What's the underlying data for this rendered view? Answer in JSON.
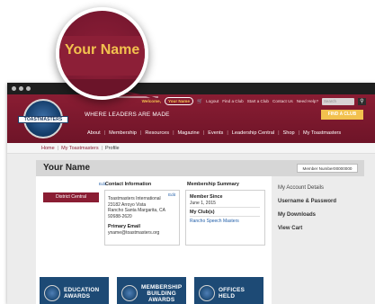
{
  "magnifier": {
    "text": "Your Name"
  },
  "topnav": {
    "welcome": "Welcome,",
    "name": "Your Name",
    "logout": "Logout",
    "find_club": "Find a Club",
    "start_club": "Start a Club",
    "contact": "Contact Us",
    "need_help": "Need Help?",
    "search_placeholder": "Search"
  },
  "brand": {
    "logo_text": "TOASTMASTERS",
    "tagline": "WHERE LEADERS ARE MADE",
    "find_club_button": "FIND A CLUB"
  },
  "mainnav": [
    "About",
    "Membership",
    "Resources",
    "Magazine",
    "Events",
    "Leadership Central",
    "Shop",
    "My Toastmasters"
  ],
  "breadcrumb": [
    "Home",
    "My Toastmasters",
    "Profile"
  ],
  "profile": {
    "name": "Your Name",
    "member_number": "Member Number00000000"
  },
  "left": {
    "edit": "Edit",
    "district": "District Central"
  },
  "contact": {
    "heading": "Contact Information",
    "edit": "Edit",
    "org": "Toastmasters International",
    "street": "23182 Arroyo Vista",
    "city": "Rancho Santa Margarita, CA",
    "zip": "92688-2620",
    "email_label": "Primary Email",
    "email": "yname@toastmasters.org"
  },
  "membership": {
    "heading": "Membership Summary",
    "since_label": "Member Since",
    "since_value": "June 1, 2015",
    "clubs_label": "My Club(s)",
    "club": "Rancho Speech Masters"
  },
  "account": [
    "My Account Details",
    "Username & Password",
    "My Downloads",
    "View Cart"
  ],
  "tiles": [
    {
      "line1": "EDUCATION",
      "line2": "AWARDS",
      "line3": ""
    },
    {
      "line1": "MEMBERSHIP",
      "line2": "BUILDING",
      "line3": "AWARDS"
    },
    {
      "line1": "OFFICES",
      "line2": "HELD",
      "line3": ""
    }
  ],
  "colors": {
    "brand": "#8a1d33",
    "accent": "#f2c14e",
    "navy": "#1d4a75",
    "link": "#1f5da8"
  }
}
